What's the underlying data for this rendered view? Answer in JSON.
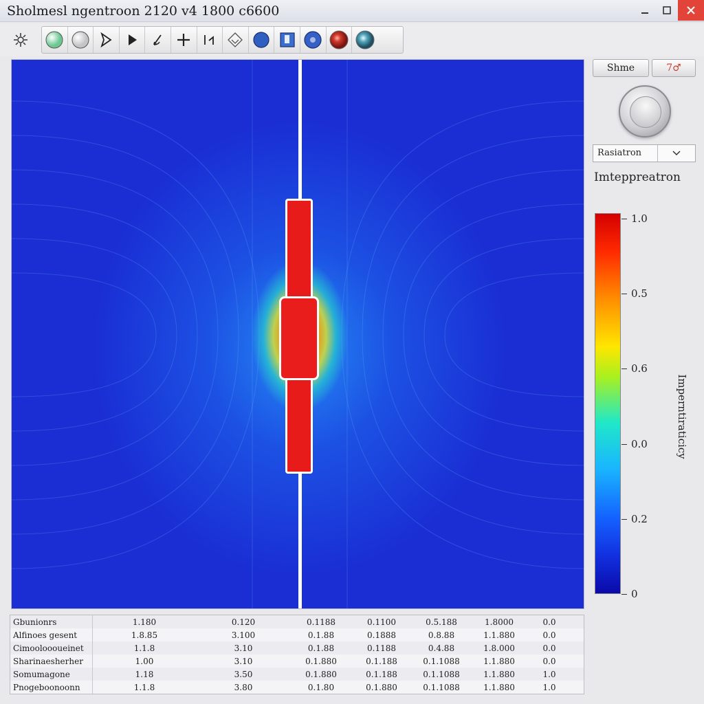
{
  "window": {
    "title": "Sholmesl ngentroon 2120 v4 1800 c6600",
    "controls": {
      "minimize_icon": "minimize-icon",
      "maximize_icon": "maximize-icon",
      "close_icon": "close-icon"
    }
  },
  "toolbar": {
    "tools": [
      {
        "name": "tool-green-sphere",
        "icon": "sphere-icon",
        "color": "#8fd6a8"
      },
      {
        "name": "tool-white-sphere",
        "icon": "sphere-icon",
        "color": "#f2f2f2"
      },
      {
        "name": "tool-select",
        "icon": "cursor-arrow-icon"
      },
      {
        "name": "tool-play",
        "icon": "play-icon"
      },
      {
        "name": "tool-draw",
        "icon": "pen-icon"
      },
      {
        "name": "tool-add",
        "icon": "plus-icon"
      },
      {
        "name": "tool-measure",
        "icon": "bracket-icon"
      },
      {
        "name": "tool-erase",
        "icon": "diamond-icon"
      },
      {
        "name": "tool-blue-dot",
        "icon": "dot-icon",
        "color": "#2f5fc0"
      },
      {
        "name": "tool-square",
        "icon": "square-icon",
        "color": "#3a6ed0"
      },
      {
        "name": "tool-ring",
        "icon": "ring-icon",
        "color": "#3560c8"
      },
      {
        "name": "tool-red-ball",
        "icon": "ball-icon",
        "color": "#d23a2a"
      },
      {
        "name": "tool-teal-ball",
        "icon": "ball-icon",
        "color": "#4fa3b8"
      }
    ]
  },
  "panel": {
    "button1": "Shme",
    "button2": "7♂",
    "select_value": "Rasiatron",
    "colorbar_title": "Imteppreatron",
    "colorbar_axis_label": "Imperntiraticicy",
    "ticks": [
      {
        "label": "1.0",
        "value": 1.0
      },
      {
        "label": "0.5",
        "value": 0.8
      },
      {
        "label": "0.6",
        "value": 0.6
      },
      {
        "label": "0.0",
        "value": 0.4
      },
      {
        "label": "0.2",
        "value": 0.2
      },
      {
        "label": "0",
        "value": 0.0
      }
    ]
  },
  "table": {
    "rows": [
      {
        "name": "Gbunionrs",
        "cells": [
          "1.180",
          "0.120",
          "0.1188",
          "0.1100",
          "0.5.188",
          "1.8000",
          "0.0"
        ]
      },
      {
        "name": "Alfinoes gesent",
        "cells": [
          "1.8.85",
          "3.100",
          "0.1.88",
          "0.1888",
          "0.8.88",
          "1.1.880",
          "0.0"
        ]
      },
      {
        "name": "Cimooloooueinet",
        "cells": [
          "1.1.8",
          "3.10",
          "0.1.88",
          "0.1188",
          "0.4.88",
          "1.8.000",
          "0.0"
        ]
      },
      {
        "name": "Sharinaesherher",
        "cells": [
          "1.00",
          "3.10",
          "0.1.880",
          "0.1.188",
          "0.1.1088",
          "1.1.880",
          "0.0"
        ]
      },
      {
        "name": "Somumagone",
        "cells": [
          "1.18",
          "3.50",
          "0.1.880",
          "0.1.188",
          "0.1.1088",
          "1.1.880",
          "1.0"
        ]
      },
      {
        "name": "Pnogeboonoonn",
        "cells": [
          "1.1.8",
          "3.80",
          "0.1.80",
          "0.1.880",
          "0.1.1088",
          "1.1.880",
          "1.0"
        ]
      }
    ]
  }
}
